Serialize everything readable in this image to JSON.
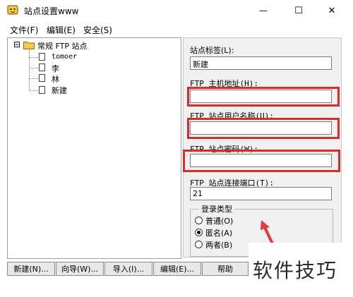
{
  "window": {
    "title": "站点设置www",
    "minimize_glyph": "—",
    "maximize_glyph": "☐",
    "close_glyph": "✕"
  },
  "menu": {
    "items": [
      {
        "label": "文件(F)"
      },
      {
        "label": "编辑(E)"
      },
      {
        "label": "安全(S)"
      }
    ]
  },
  "tree": {
    "root": {
      "toggle": "⊟",
      "label": "常规 FTP 站点"
    },
    "children": [
      {
        "label": "tomoer"
      },
      {
        "label": "李"
      },
      {
        "label": "林"
      },
      {
        "label": "新建"
      }
    ]
  },
  "form": {
    "site_label": {
      "label": "站点标签(L):",
      "value": "新建"
    },
    "host": {
      "label": "FTP 主机地址(H):",
      "value": ""
    },
    "username": {
      "label": "FTP 站点用户名称(U):",
      "value": ""
    },
    "password": {
      "label": "FTP 站点密码(W):",
      "value": ""
    },
    "port": {
      "label": "FTP 站点连接端口(T):",
      "value": "21"
    },
    "login_type": {
      "title": "登录类型",
      "options": [
        {
          "label": "普通(O)",
          "checked": false
        },
        {
          "label": "匿名(A)",
          "checked": true
        },
        {
          "label": "两者(B)",
          "checked": false
        }
      ]
    }
  },
  "buttons": [
    {
      "label": "新建(N)..."
    },
    {
      "label": "向导(W)..."
    },
    {
      "label": "导入(I)..."
    },
    {
      "label": "编辑(E)..."
    },
    {
      "label": "帮助"
    }
  ],
  "watermark": {
    "text": "软件技巧"
  },
  "colors": {
    "highlight_border": "#d82c2c",
    "annotation_arrow": "#e23b3b",
    "folder": "#f2c94c"
  }
}
